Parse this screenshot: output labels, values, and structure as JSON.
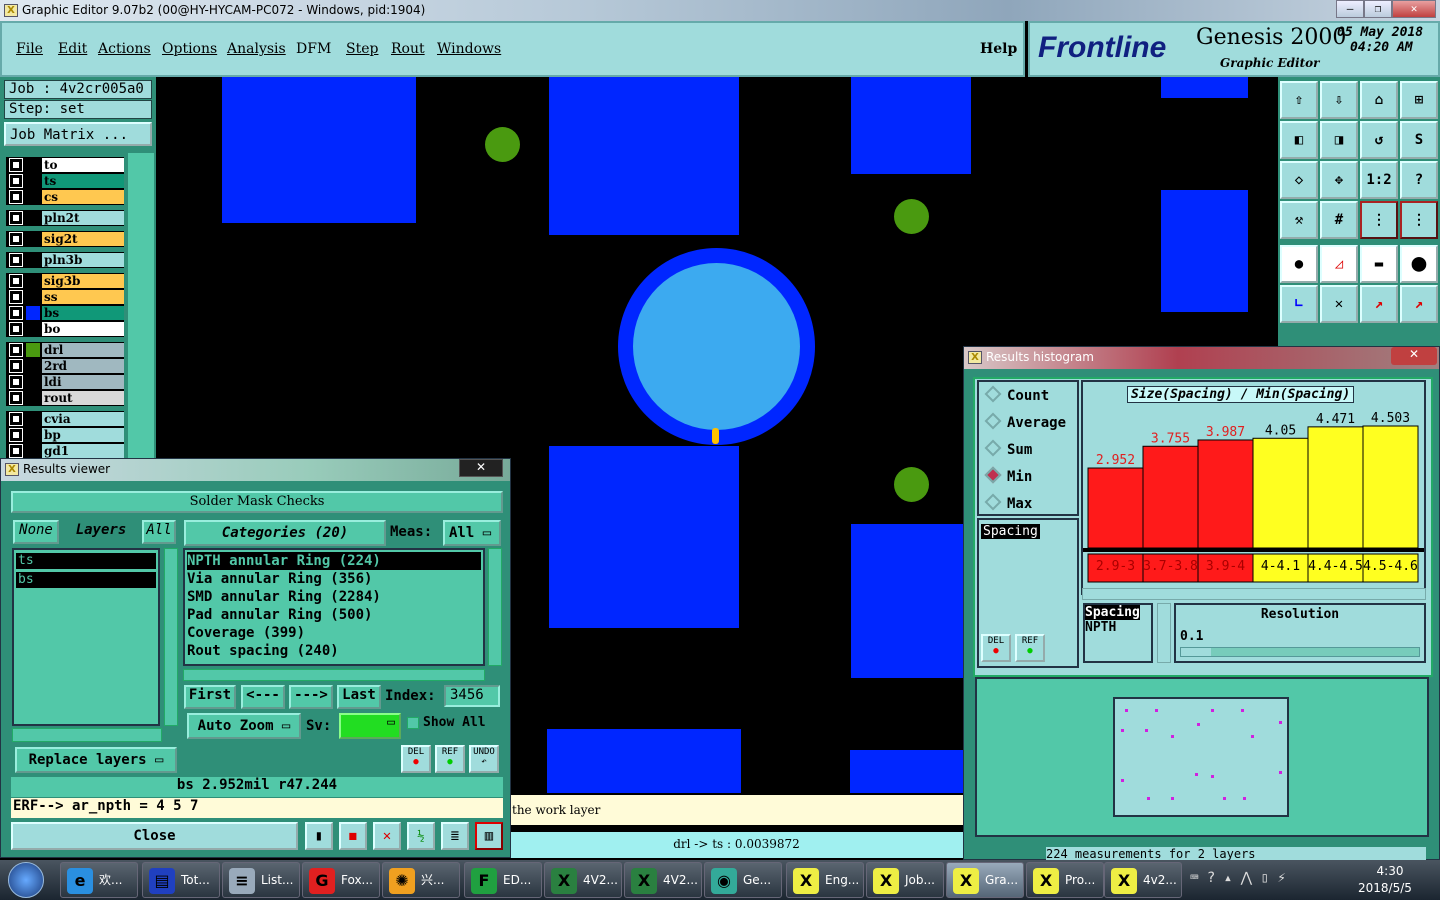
{
  "window": {
    "title": "Graphic Editor 9.07b2 (00@HY-HYCAM-PC072 - Windows, pid:1904)"
  },
  "menu": {
    "items": [
      "File",
      "Edit",
      "Actions",
      "Options",
      "Analysis",
      "DFM",
      "Step",
      "Rout",
      "Windows"
    ],
    "help": "Help"
  },
  "logo": {
    "brand": "Frontline",
    "product": "Genesis 2000",
    "subtitle": "Graphic Editor",
    "date": "05 May 2018",
    "time": "04:20 AM"
  },
  "job": {
    "job_label": "Job : 4v2cr005a0",
    "step_label": "Step: set",
    "matrix_button": "Job Matrix ..."
  },
  "layers": [
    {
      "name": "to",
      "color": "#ffffff"
    },
    {
      "name": "ts",
      "color": "#109878"
    },
    {
      "name": "cs",
      "color": "#ffc850"
    },
    {
      "name": "pln2t",
      "color": "#a0dcdc"
    },
    {
      "name": "sig2t",
      "color": "#ffc850"
    },
    {
      "name": "pln3b",
      "color": "#a0dcdc"
    },
    {
      "name": "sig3b",
      "color": "#ffc850"
    },
    {
      "name": "ss",
      "color": "#ffc850"
    },
    {
      "name": "bs",
      "color": "#109878"
    },
    {
      "name": "bo",
      "color": "#ffffff"
    },
    {
      "name": "drl",
      "color": "#a0b8c0"
    },
    {
      "name": "2rd",
      "color": "#a0b8c0"
    },
    {
      "name": "ldi",
      "color": "#a0b8c0"
    },
    {
      "name": "rout",
      "color": "#d8d8d8"
    },
    {
      "name": "cvia",
      "color": "#a0dcdc"
    },
    {
      "name": "bp",
      "color": "#a0dcdc"
    },
    {
      "name": "gd1",
      "color": "#a0dcdc"
    }
  ],
  "results_viewer": {
    "title": "Results viewer",
    "heading": "Solder Mask Checks",
    "none": "None",
    "layers": "Layers",
    "all": "All",
    "layer_list": [
      "ts",
      "bs"
    ],
    "categories": "Categories (20)",
    "meas_label": "Meas:",
    "meas_value": "All",
    "category_list": [
      "NPTH annular Ring (224)",
      "Via annular Ring (356)",
      "SMD annular Ring (2284)",
      "Pad annular Ring (500)",
      "Coverage (399)",
      "Rout spacing (240)"
    ],
    "first": "First",
    "prev": "<---",
    "next": "--->",
    "last": "Last",
    "index_label": "Index:",
    "index_value": "3456",
    "auto_zoom": "Auto Zoom",
    "sv_label": "Sv:",
    "show_all": "Show All",
    "replace_layers": "Replace layers",
    "del": "DEL",
    "ref": "REF",
    "undo": "UNDO",
    "measure": "bs 2.952mil   r47.244",
    "erf": "ERF--> ar_npth = 4 5 7",
    "close": "Close"
  },
  "messages": {
    "work_layer": "the work layer",
    "drill": "drl -> ts : 0.0039872"
  },
  "histogram": {
    "title": "Results histogram",
    "modes": [
      "Count",
      "Average",
      "Sum",
      "Min",
      "Max"
    ],
    "selected_mode": "Min",
    "left_list": [
      "Spacing"
    ],
    "sub_list": [
      "Spacing",
      "NPTH"
    ],
    "resolution_label": "Resolution",
    "resolution_value": "0.1",
    "del": "DEL",
    "ref": "REF",
    "status": "224 measurements for 2 layers"
  },
  "chart_data": {
    "type": "bar",
    "title": "Size(Spacing) / Min(Spacing)",
    "categories": [
      "2.9-3",
      "3.7-3.8",
      "3.9-4",
      "4-4.1",
      "4.4-4.5",
      "4.5-4.6"
    ],
    "values": [
      2.952,
      3.755,
      3.987,
      4.05,
      4.471,
      4.503
    ],
    "labels": [
      "2.952",
      "3.755",
      "3.987",
      "4.05",
      "4.471",
      "4.503"
    ],
    "bar_colors": [
      "#ff1a1a",
      "#ff1a1a",
      "#ff1a1a",
      "#ffff20",
      "#ffff20",
      "#ffff20"
    ],
    "label_colors": [
      "#e02020",
      "#e02020",
      "#e02020",
      "#000000",
      "#000000",
      "#000000"
    ],
    "ylim": [
      0,
      4.6
    ]
  },
  "taskbar": {
    "items": [
      {
        "label": "欢...",
        "icon": "e",
        "color": "#2a8fe0"
      },
      {
        "label": "Tot...",
        "icon": "▤",
        "color": "#2040c0"
      },
      {
        "label": "List...",
        "icon": "≡",
        "color": "#9ab"
      },
      {
        "label": "Fox...",
        "icon": "G",
        "color": "#e02020"
      },
      {
        "label": "兴...",
        "icon": "✺",
        "color": "#f0a020"
      },
      {
        "label": "ED...",
        "icon": "F",
        "color": "#20a040"
      },
      {
        "label": "4V2...",
        "icon": "X",
        "color": "#2a8040"
      },
      {
        "label": "4V2...",
        "icon": "X",
        "color": "#2a8040"
      },
      {
        "label": "Ge...",
        "icon": "◉",
        "color": "#3a9"
      },
      {
        "label": "Eng...",
        "icon": "X",
        "color": "#ee4"
      },
      {
        "label": "Job...",
        "icon": "X",
        "color": "#ee4"
      },
      {
        "label": "Gra...",
        "icon": "X",
        "color": "#ee4"
      },
      {
        "label": "Pro...",
        "icon": "X",
        "color": "#ee4"
      },
      {
        "label": "4v2...",
        "icon": "X",
        "color": "#ee4"
      }
    ],
    "clock_time": "4:30",
    "clock_date": "2018/5/5"
  }
}
